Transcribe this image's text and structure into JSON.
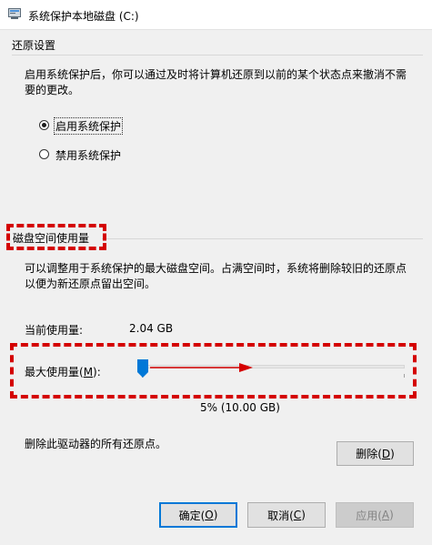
{
  "window": {
    "title": "系统保护本地磁盘 (C:)"
  },
  "restore_settings": {
    "group_title": "还原设置",
    "description_line1": "启用系统保护后，你可以通过及时将计算机还原到以前的某个状态点来撤消不需",
    "description_line2": "要的更改。",
    "options": [
      {
        "label": "启用系统保护",
        "selected": true
      },
      {
        "label": "禁用系统保护",
        "selected": false
      }
    ]
  },
  "disk_usage": {
    "group_title": "磁盘空间使用量",
    "description_line1": "可以调整用于系统保护的最大磁盘空间。占满空间时，系统将删除较旧的还原点",
    "description_line2": "以便为新还原点留出空间。",
    "current_usage_label": "当前使用量:",
    "current_usage_value": "2.04 GB",
    "max_usage_label_prefix": "最大使用量(",
    "max_usage_accel": "M",
    "max_usage_label_suffix": "):",
    "max_usage_percent": 5,
    "max_usage_readout": "5% (10.00 GB)"
  },
  "delete_section": {
    "text": "删除此驱动器的所有还原点。",
    "delete_button": {
      "prefix": "删除(",
      "accel": "D",
      "suffix": ")"
    }
  },
  "footer": {
    "ok_button": {
      "prefix": "确定(",
      "accel": "O",
      "suffix": ")"
    },
    "cancel_button": {
      "prefix": "取消(",
      "accel": "C",
      "suffix": ")"
    },
    "apply_button": {
      "prefix": "应用(",
      "accel": "A",
      "suffix": ")",
      "enabled": false
    }
  },
  "colors": {
    "highlight_red": "#d40000",
    "slider_blue": "#0078d7",
    "accent": "#0078d7"
  }
}
